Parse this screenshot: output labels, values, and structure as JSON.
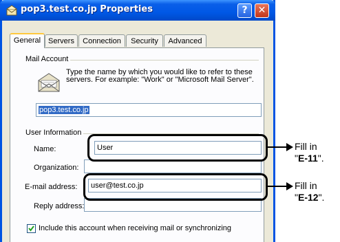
{
  "window": {
    "title": "pop3.test.co.jp Properties",
    "help_label": "?",
    "close_label": "✕"
  },
  "tabs": [
    {
      "label": "General"
    },
    {
      "label": "Servers"
    },
    {
      "label": "Connection"
    },
    {
      "label": "Security"
    },
    {
      "label": "Advanced"
    }
  ],
  "mail_account": {
    "group_label": "Mail Account",
    "description": "Type the name by which you would like to refer to these servers.  For example: \"Work\" or \"Microsoft Mail Server\".",
    "account_name": "pop3.test.co.jp"
  },
  "user_information": {
    "group_label": "User Information",
    "name_label": "Name:",
    "name_value": "User",
    "organization_label": "Organization:",
    "organization_value": "",
    "email_label": "E-mail address:",
    "email_value": "user@test.co.jp",
    "reply_label": "Reply address:",
    "reply_value": ""
  },
  "include_checkbox": {
    "label": "Include this account when receiving mail or synchronizing",
    "checked": true
  },
  "annotations": [
    {
      "prefix": "Fill in",
      "open_quote": "\"",
      "code": "E-11",
      "close_quote": "\"."
    },
    {
      "prefix": "Fill in",
      "open_quote": "\"",
      "code": "E-12",
      "close_quote": "\"."
    }
  ]
}
